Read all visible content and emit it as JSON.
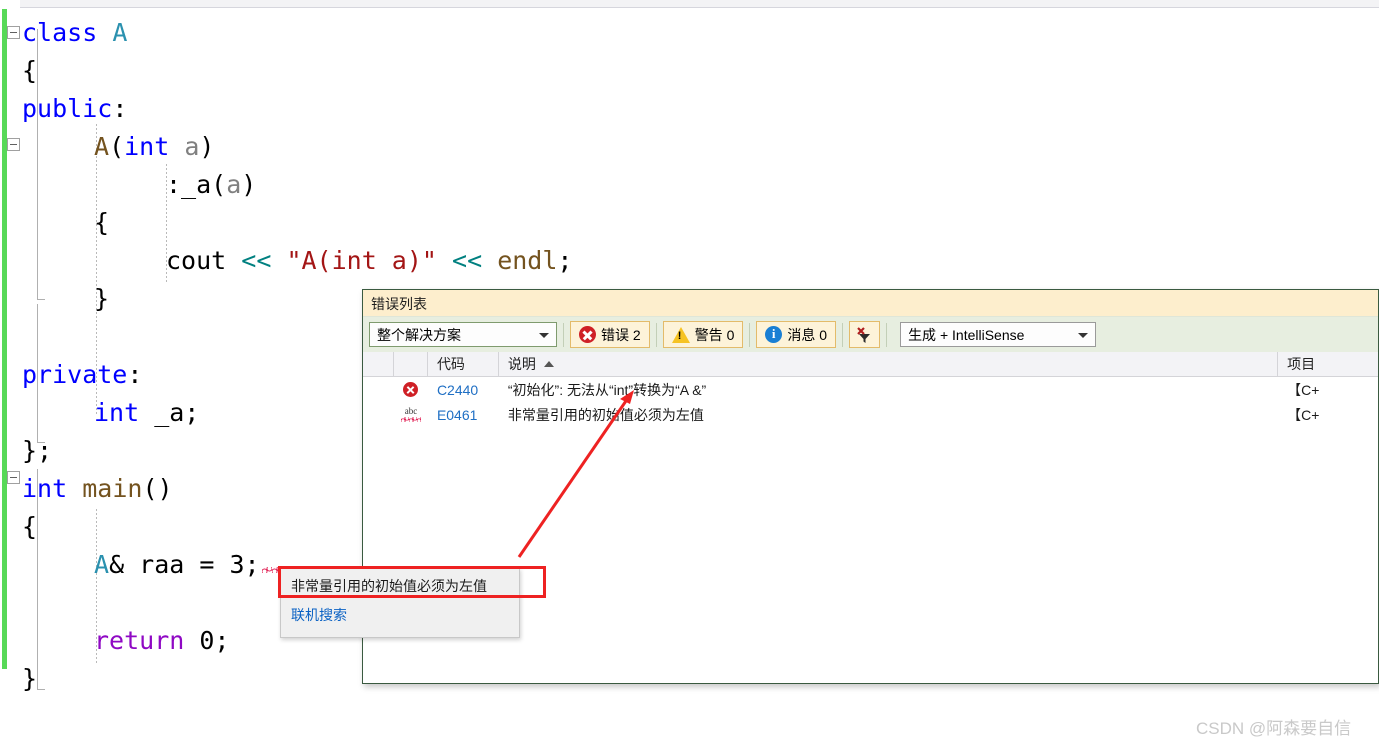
{
  "editor": {
    "lines": [
      {
        "indent": 0,
        "tokens": [
          {
            "t": "class ",
            "c": "kw"
          },
          {
            "t": "A",
            "c": "type"
          }
        ]
      },
      {
        "indent": 0,
        "tokens": [
          {
            "t": "{",
            "c": ""
          }
        ]
      },
      {
        "indent": 0,
        "tokens": [
          {
            "t": "public",
            "c": "kw"
          },
          {
            "t": ":",
            "c": ""
          }
        ]
      },
      {
        "indent": 1,
        "tokens": [
          {
            "t": "A",
            "c": "fn"
          },
          {
            "t": "(",
            "c": ""
          },
          {
            "t": "int",
            "c": "kw"
          },
          {
            "t": " ",
            "c": ""
          },
          {
            "t": "a",
            "c": "param"
          },
          {
            "t": ")",
            "c": ""
          }
        ]
      },
      {
        "indent": 2,
        "tokens": [
          {
            "t": ":_a(",
            "c": ""
          },
          {
            "t": "a",
            "c": "param"
          },
          {
            "t": ")",
            "c": ""
          }
        ]
      },
      {
        "indent": 1,
        "tokens": [
          {
            "t": "{",
            "c": ""
          }
        ]
      },
      {
        "indent": 2,
        "tokens": [
          {
            "t": "cout ",
            "c": ""
          },
          {
            "t": "<<",
            "c": "op"
          },
          {
            "t": " ",
            "c": ""
          },
          {
            "t": "\"A(int a)\"",
            "c": "str"
          },
          {
            "t": " ",
            "c": ""
          },
          {
            "t": "<<",
            "c": "op"
          },
          {
            "t": " ",
            "c": ""
          },
          {
            "t": "endl",
            "c": "fn"
          },
          {
            "t": ";",
            "c": ""
          }
        ]
      },
      {
        "indent": 1,
        "tokens": [
          {
            "t": "}",
            "c": ""
          }
        ]
      },
      {
        "indent": 0,
        "tokens": []
      },
      {
        "indent": 0,
        "tokens": [
          {
            "t": "private",
            "c": "kw"
          },
          {
            "t": ":",
            "c": ""
          }
        ]
      },
      {
        "indent": 1,
        "tokens": [
          {
            "t": "int",
            "c": "kw"
          },
          {
            "t": " _a;",
            "c": ""
          }
        ]
      },
      {
        "indent": 0,
        "tokens": [
          {
            "t": "};",
            "c": ""
          }
        ]
      },
      {
        "indent": 0,
        "tokens": [
          {
            "t": "int",
            "c": "kw"
          },
          {
            "t": " ",
            "c": ""
          },
          {
            "t": "main",
            "c": "fn"
          },
          {
            "t": "()",
            "c": ""
          }
        ]
      },
      {
        "indent": 0,
        "tokens": [
          {
            "t": "{",
            "c": ""
          }
        ]
      },
      {
        "indent": 1,
        "tokens": [
          {
            "t": "A",
            "c": "type"
          },
          {
            "t": "& raa ",
            "c": ""
          },
          {
            "t": "=",
            "c": ""
          },
          {
            "t": " 3;",
            "c": ""
          }
        ]
      },
      {
        "indent": 0,
        "tokens": []
      },
      {
        "indent": 1,
        "tokens": [
          {
            "t": "return",
            "c": "ctl"
          },
          {
            "t": " 0;",
            "c": ""
          }
        ]
      },
      {
        "indent": 0,
        "tokens": [
          {
            "t": "}",
            "c": ""
          }
        ]
      }
    ]
  },
  "error_panel": {
    "title": "错误列表",
    "scope_selected": "整个解决方案",
    "counters": [
      {
        "icon": "error-icon",
        "label": "错误 2"
      },
      {
        "icon": "warning-icon",
        "label": "警告 0"
      },
      {
        "icon": "info-icon",
        "label": "消息 0"
      }
    ],
    "clear_filter_tooltip": "清除筛选器",
    "build_scope_selected": "生成 + IntelliSense",
    "columns": [
      "",
      "",
      "代码",
      "说明",
      "项目"
    ],
    "sort_indicator_column": "说明",
    "rows": [
      {
        "icon": "error-icon",
        "code": "C2440",
        "description": "“初始化”: 无法从“int”转换为“A &”",
        "project": "【C+"
      },
      {
        "icon": "intellisense-icon",
        "code": "E0461",
        "description": "非常量引用的初始值必须为左值",
        "project": "【C+"
      }
    ]
  },
  "quickinfo": {
    "message": "非常量引用的初始值必须为左值",
    "link": "联机搜索"
  },
  "watermark": {
    "text": "CSDN @阿森要自信"
  },
  "colors": {
    "keyword": "#0000ff",
    "type": "#2b91af",
    "function": "#74531f",
    "string": "#a31515",
    "operator": "#008080",
    "control": "#8f08c4",
    "parameter": "#808080",
    "error_red": "#cf2026",
    "warning_yellow": "#f6c324",
    "info_blue": "#1a7fd4",
    "link_blue": "#1f6fc4",
    "change_bar_green": "#57d957",
    "annotation_red": "#ee2222",
    "panel_title_bg": "#fdeecd",
    "panel_toolbar_bg": "#e7eee0"
  }
}
